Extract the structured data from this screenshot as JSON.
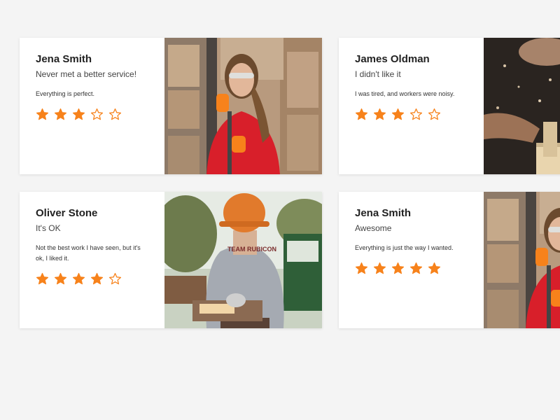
{
  "colors": {
    "accent": "#f7821b",
    "background": "#f4f4f4",
    "card": "#ffffff"
  },
  "reviews": [
    {
      "name": "Jena Smith",
      "title": "Never met a better service!",
      "text": "Everything is perfect.",
      "rating": 3,
      "max_rating": 5,
      "photo": "worker-woman-red-jacket-photo"
    },
    {
      "name": "James Oldman",
      "title": "I didn't like it",
      "text": "I was tired, and workers were noisy.",
      "rating": 3,
      "max_rating": 5,
      "photo": "worker-sawing-wood-photo"
    },
    {
      "name": "Oliver Stone",
      "title": "It's OK",
      "text": "Not the best work I have seen, but it's ok, I liked it.",
      "rating": 4,
      "max_rating": 5,
      "photo": "worker-orange-hardhat-photo"
    },
    {
      "name": "Jena Smith",
      "title": "Awesome",
      "text": "Everything is just the way I wanted.",
      "rating": 5,
      "max_rating": 5,
      "photo": "worker-woman-red-jacket-photo"
    }
  ],
  "print_badge": "TEAM RUBICON"
}
